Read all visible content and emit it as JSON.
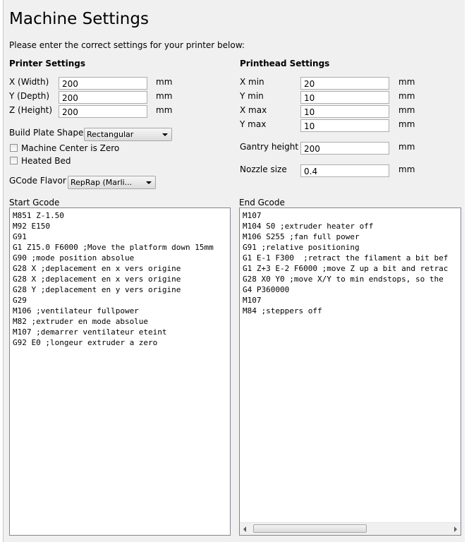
{
  "window": {
    "title": "Machine Settings",
    "subtitle": "Please enter the correct settings for your printer below:"
  },
  "printer": {
    "heading": "Printer Settings",
    "width_label": "X (Width)",
    "width_value": "200",
    "depth_label": "Y (Depth)",
    "depth_value": "200",
    "height_label": "Z (Height)",
    "height_value": "200",
    "unit": "mm",
    "build_plate_label": "Build Plate Shape",
    "build_plate_value": "Rectangular",
    "center_zero_label": "Machine Center is Zero",
    "center_zero_checked": false,
    "heated_bed_label": "Heated Bed",
    "heated_bed_checked": false,
    "gcode_flavor_label": "GCode Flavor",
    "gcode_flavor_value": "RepRap (Marli..."
  },
  "printhead": {
    "heading": "Printhead Settings",
    "xmin_label": "X min",
    "xmin_value": "20",
    "ymin_label": "Y min",
    "ymin_value": "10",
    "xmax_label": "X max",
    "xmax_value": "10",
    "ymax_label": "Y max",
    "ymax_value": "10",
    "gantry_label": "Gantry height",
    "gantry_value": "200",
    "nozzle_label": "Nozzle size",
    "nozzle_value": "0.4",
    "unit": "mm"
  },
  "start_gcode": {
    "label": "Start Gcode",
    "text": "M851 Z-1.50\nM92 E150\nG91\nG1 Z15.0 F6000 ;Move the platform down 15mm\nG90 ;mode position absolue\nG28 X ;deplacement en x vers origine\nG28 X ;deplacement en x vers origine\nG28 Y ;deplacement en y vers origine\nG29\nM106 ;ventilateur fullpower\nM82 ;extruder en mode absolue\nM107 ;demarrer ventilateur eteint\nG92 E0 ;longeur extruder a zero"
  },
  "end_gcode": {
    "label": "End Gcode",
    "text": "M107\nM104 S0 ;extruder heater off\nM106 S255 ;fan full power\nG91 ;relative positioning\nG1 E-1 F300  ;retract the filament a bit bef\nG1 Z+3 E-2 F6000 ;move Z up a bit and retrac\nG28 X0 Y0 ;move X/Y to min endstops, so the \nG4 P360000\nM107\nM84 ;steppers off"
  },
  "icons": {
    "dropdown": "chevron-down-icon",
    "scroll_left": "scroll-left-icon",
    "scroll_right": "scroll-right-icon"
  }
}
